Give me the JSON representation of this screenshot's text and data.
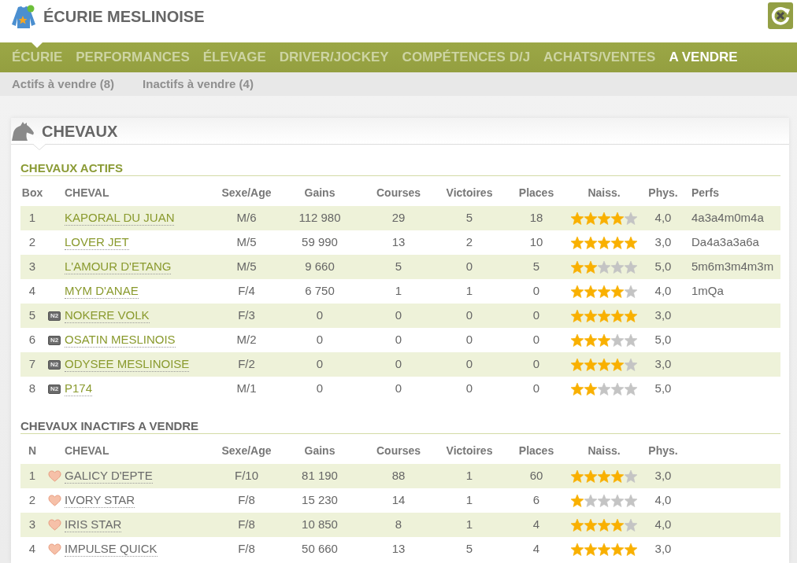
{
  "header": {
    "title": "ÉCURIE MESLINOISE"
  },
  "nav": [
    {
      "label": "ÉCURIE",
      "selected": false
    },
    {
      "label": "PERFORMANCES",
      "selected": false
    },
    {
      "label": "ÉLEVAGE",
      "selected": false
    },
    {
      "label": "DRIVER/JOCKEY",
      "selected": false
    },
    {
      "label": "COMPÉTENCES D/J",
      "selected": false
    },
    {
      "label": "ACHATS/VENTES",
      "selected": false
    },
    {
      "label": "A VENDRE",
      "selected": true
    }
  ],
  "subnav": [
    {
      "label": "Actifs à vendre (8)"
    },
    {
      "label": "Inactifs à vendre (4)"
    }
  ],
  "panel": {
    "title": "CHEVAUX",
    "sections": [
      {
        "kind": "active",
        "title": "CHEVAUX ACTIFS",
        "columns": [
          "Box",
          "CHEVAL",
          "Sexe/Age",
          "Gains",
          "Courses",
          "Victoires",
          "Places",
          "Naiss.",
          "Phys.",
          "Perfs"
        ],
        "rows": [
          {
            "number": "1",
            "name": "KAPORAL DU JUAN",
            "stats": [
              "M/6",
              "112 980",
              "29",
              "5",
              "18"
            ],
            "stars": 4,
            "phys": "4,0",
            "perfs": "4a3a4m0m4a"
          },
          {
            "number": "2",
            "name": "LOVER JET",
            "stats": [
              "M/5",
              "59 990",
              "13",
              "2",
              "10"
            ],
            "stars": 5,
            "phys": "3,0",
            "perfs": "Da4a3a3a6a"
          },
          {
            "number": "3",
            "name": "L'AMOUR D'ETANG",
            "stats": [
              "M/5",
              "9 660",
              "5",
              "0",
              "5"
            ],
            "stars": 2,
            "phys": "5,0",
            "perfs": "5m6m3m4m3m"
          },
          {
            "number": "4",
            "name": "MYM D'ANAE",
            "stats": [
              "F/4",
              "6 750",
              "1",
              "1",
              "0"
            ],
            "stars": 4,
            "phys": "4,0",
            "perfs": "1mQa"
          },
          {
            "number": "5",
            "tag": "N2",
            "name": "NOKERE VOLK",
            "stats": [
              "F/3",
              "0",
              "0",
              "0",
              "0"
            ],
            "stars": 5,
            "phys": "3,0"
          },
          {
            "number": "6",
            "tag": "N2",
            "name": "OSATIN MESLINOIS",
            "stats": [
              "M/2",
              "0",
              "0",
              "0",
              "0"
            ],
            "stars": 3,
            "phys": "5,0"
          },
          {
            "number": "7",
            "tag": "N2",
            "name": "ODYSEE MESLINOISE",
            "stats": [
              "F/2",
              "0",
              "0",
              "0",
              "0"
            ],
            "stars": 4,
            "phys": "3,0"
          },
          {
            "number": "8",
            "tag": "N2",
            "name": "P174",
            "stats": [
              "M/1",
              "0",
              "0",
              "0",
              "0"
            ],
            "stars": 2,
            "phys": "5,0"
          }
        ]
      },
      {
        "kind": "inactive",
        "title": "CHEVAUX INACTIFS A VENDRE",
        "columns": [
          "N",
          "CHEVAL",
          "Sexe/Age",
          "Gains",
          "Courses",
          "Victoires",
          "Places",
          "Naiss.",
          "Phys."
        ],
        "rows": [
          {
            "number": "1",
            "name": "GALICY D'EPTE",
            "stats": [
              "F/10",
              "81 190",
              "88",
              "1",
              "60"
            ],
            "stars": 4,
            "phys": "3,0"
          },
          {
            "number": "2",
            "name": "IVORY STAR",
            "stats": [
              "F/8",
              "15 230",
              "14",
              "1",
              "6"
            ],
            "stars": 1,
            "phys": "4,0"
          },
          {
            "number": "3",
            "name": "IRIS STAR",
            "stats": [
              "F/8",
              "10 850",
              "8",
              "1",
              "4"
            ],
            "stars": 4,
            "phys": "4,0"
          },
          {
            "number": "4",
            "name": "IMPULSE QUICK",
            "stats": [
              "F/8",
              "50 660",
              "13",
              "5",
              "4"
            ],
            "stars": 5,
            "phys": "3,0"
          }
        ]
      }
    ]
  }
}
